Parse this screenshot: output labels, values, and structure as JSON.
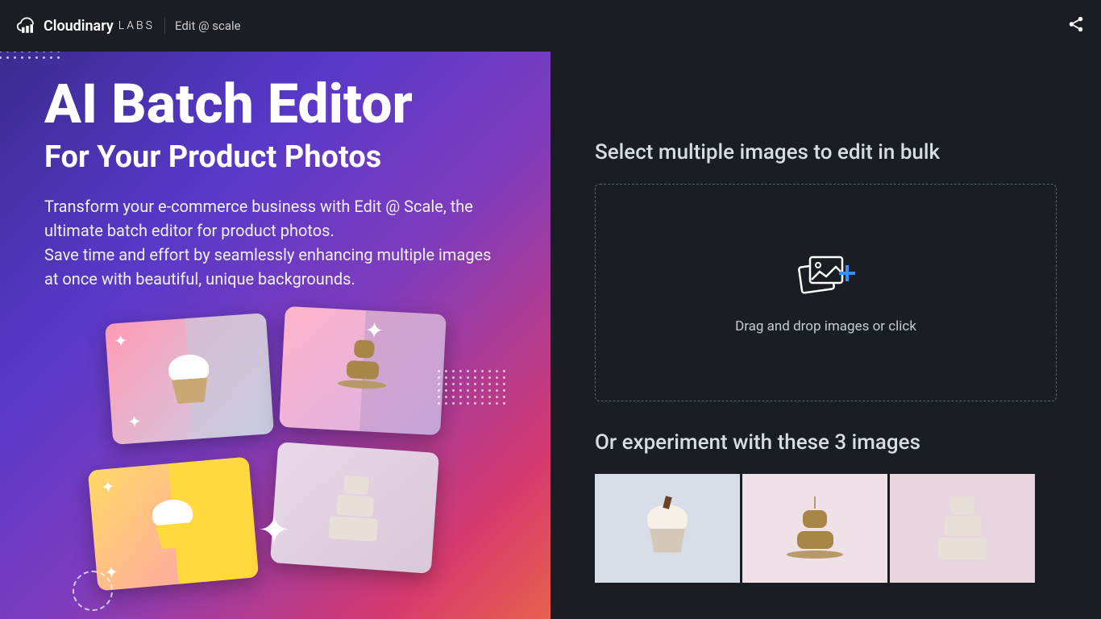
{
  "header": {
    "brand": "Cloudinary",
    "labs": "LABS",
    "product": "Edit @ scale"
  },
  "hero": {
    "title": "AI Batch Editor",
    "subtitle": "For Your Product Photos",
    "description_line1": "Transform your e-commerce business with Edit @ Scale, the ultimate batch editor for product photos.",
    "description_line2": "Save time and effort by seamlessly enhancing multiple images at once with beautiful, unique backgrounds."
  },
  "upload": {
    "heading": "Select multiple images to edit in bulk",
    "dropzone_text": "Drag and drop images or click"
  },
  "samples": {
    "heading": "Or experiment with these 3 images",
    "items": [
      {
        "name": "cupcake"
      },
      {
        "name": "macaron-tower"
      },
      {
        "name": "tiered-cake"
      }
    ]
  }
}
